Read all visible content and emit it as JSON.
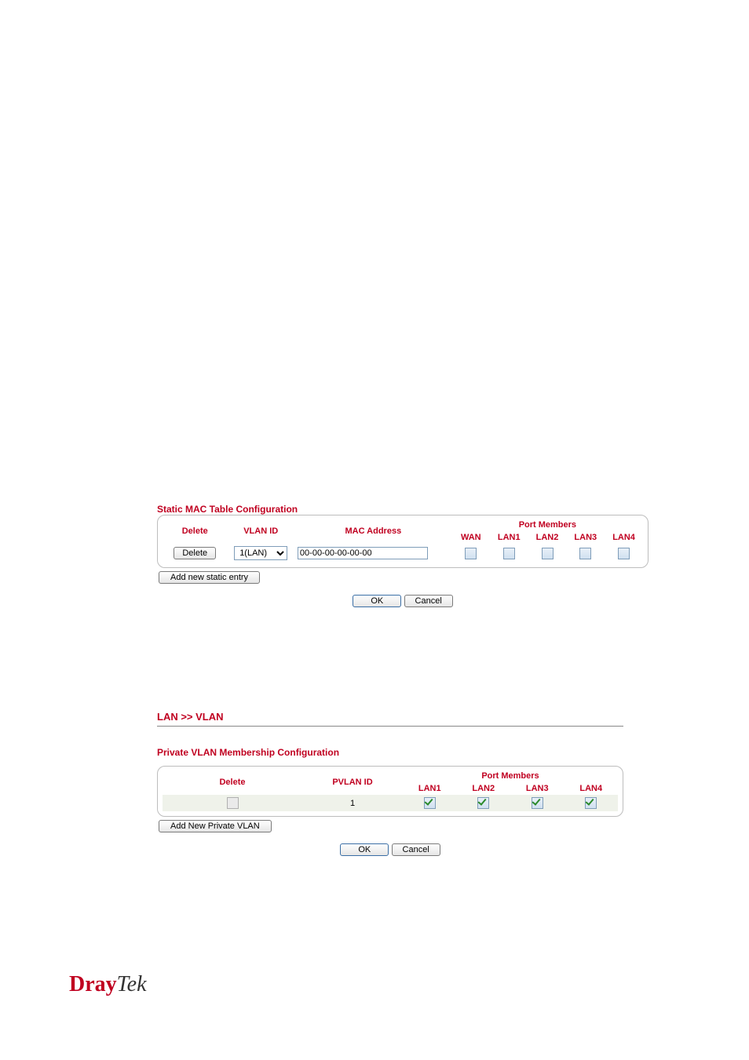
{
  "static_mac": {
    "title": "Static MAC Table Configuration",
    "headers": {
      "delete": "Delete",
      "vlan_id": "VLAN ID",
      "mac_address": "MAC Address",
      "port_members": "Port Members",
      "wan": "WAN",
      "lan1": "LAN1",
      "lan2": "LAN2",
      "lan3": "LAN3",
      "lan4": "LAN4"
    },
    "row": {
      "delete_label": "Delete",
      "vlan_id_selected": "1(LAN)",
      "mac_address": "00-00-00-00-00-00",
      "wan": false,
      "lan1": false,
      "lan2": false,
      "lan3": false,
      "lan4": false
    },
    "add_label": "Add new static entry",
    "ok_label": "OK",
    "cancel_label": "Cancel"
  },
  "vlan": {
    "breadcrumb": "LAN >> VLAN",
    "title": "Private VLAN Membership Configuration",
    "headers": {
      "delete": "Delete",
      "pvlan_id": "PVLAN ID",
      "port_members": "Port Members",
      "lan1": "LAN1",
      "lan2": "LAN2",
      "lan3": "LAN3",
      "lan4": "LAN4"
    },
    "row": {
      "delete_checked": false,
      "pvlan_id": "1",
      "lan1": true,
      "lan2": true,
      "lan3": true,
      "lan4": true
    },
    "add_label": "Add New Private VLAN",
    "ok_label": "OK",
    "cancel_label": "Cancel"
  },
  "brand": {
    "part1": "Dray",
    "part2": "Tek"
  }
}
